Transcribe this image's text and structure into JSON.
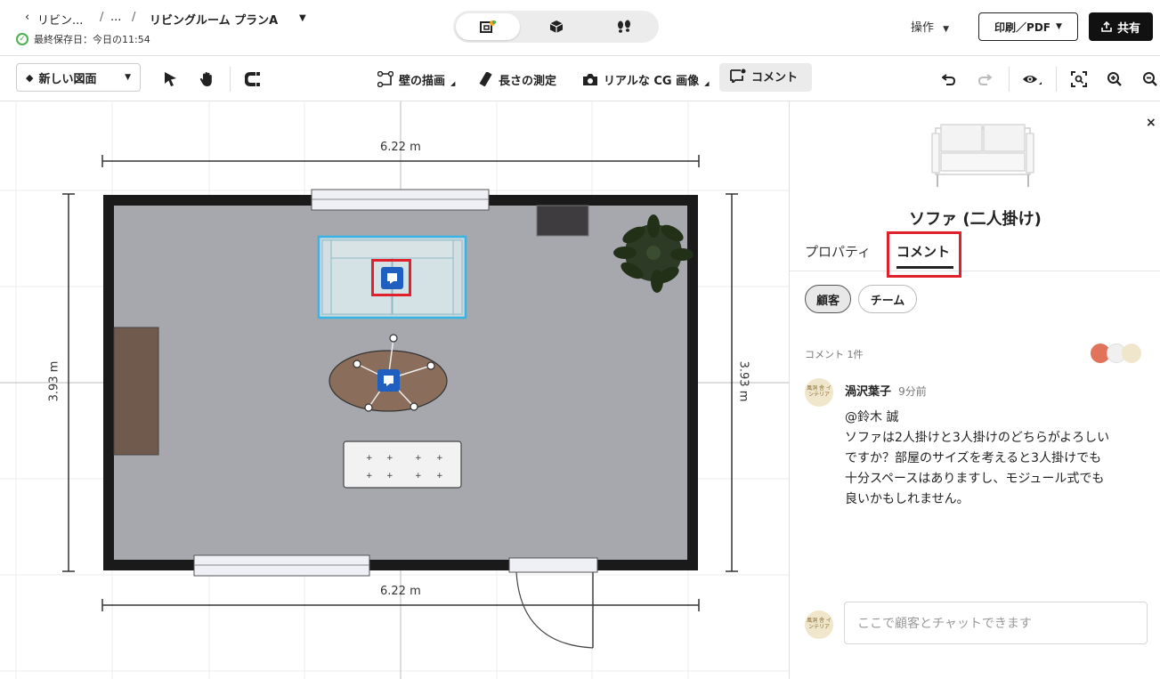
{
  "header": {
    "breadcrumb_root": "リビン...",
    "breadcrumb_sep1": "/",
    "breadcrumb_mid": "...",
    "breadcrumb_sep2": "/",
    "project_title": "リビングルーム プランA",
    "last_saved": "最終保存日：今日の11:54",
    "view_modes": [
      "2d-plan-icon",
      "3d-box-icon",
      "walkthrough-footsteps-icon"
    ],
    "actions_label": "操作",
    "print_label": "印刷／PDF",
    "share_label": "共有"
  },
  "toolbar": {
    "floor_dropdown": "新しい図面",
    "draw_walls": "壁の描画",
    "measure": "長さの測定",
    "render": "リアルな CG 画像",
    "comment": "コメント"
  },
  "canvas": {
    "dim_top": "6.22 m",
    "dim_bottom": "6.22 m",
    "dim_left": "3.93 m",
    "dim_right": "3.93 m"
  },
  "panel": {
    "item_title": "ソファ (二人掛け)",
    "tabs": [
      "プロパティ",
      "コメント"
    ],
    "active_tab": "コメント",
    "filters": [
      "顧客",
      "チーム"
    ],
    "active_filter": "顧客",
    "comment_count": "コメント 1件",
    "comment": {
      "avatar_text": "風洞 舎 インテリア",
      "author": "渦沢葉子",
      "time": "9分前",
      "lines": [
        "@鈴木 誠",
        "ソファは2人掛けと3人掛けのどちらがよろしい",
        "ですか？部屋のサイズを考えると3人掛けでも",
        "十分スペースはありますし、モジュール式でも",
        "良いかもしれません。"
      ]
    },
    "chat_placeholder": "ここで顧客とチャットできます",
    "accent_color": "#e0202a"
  }
}
